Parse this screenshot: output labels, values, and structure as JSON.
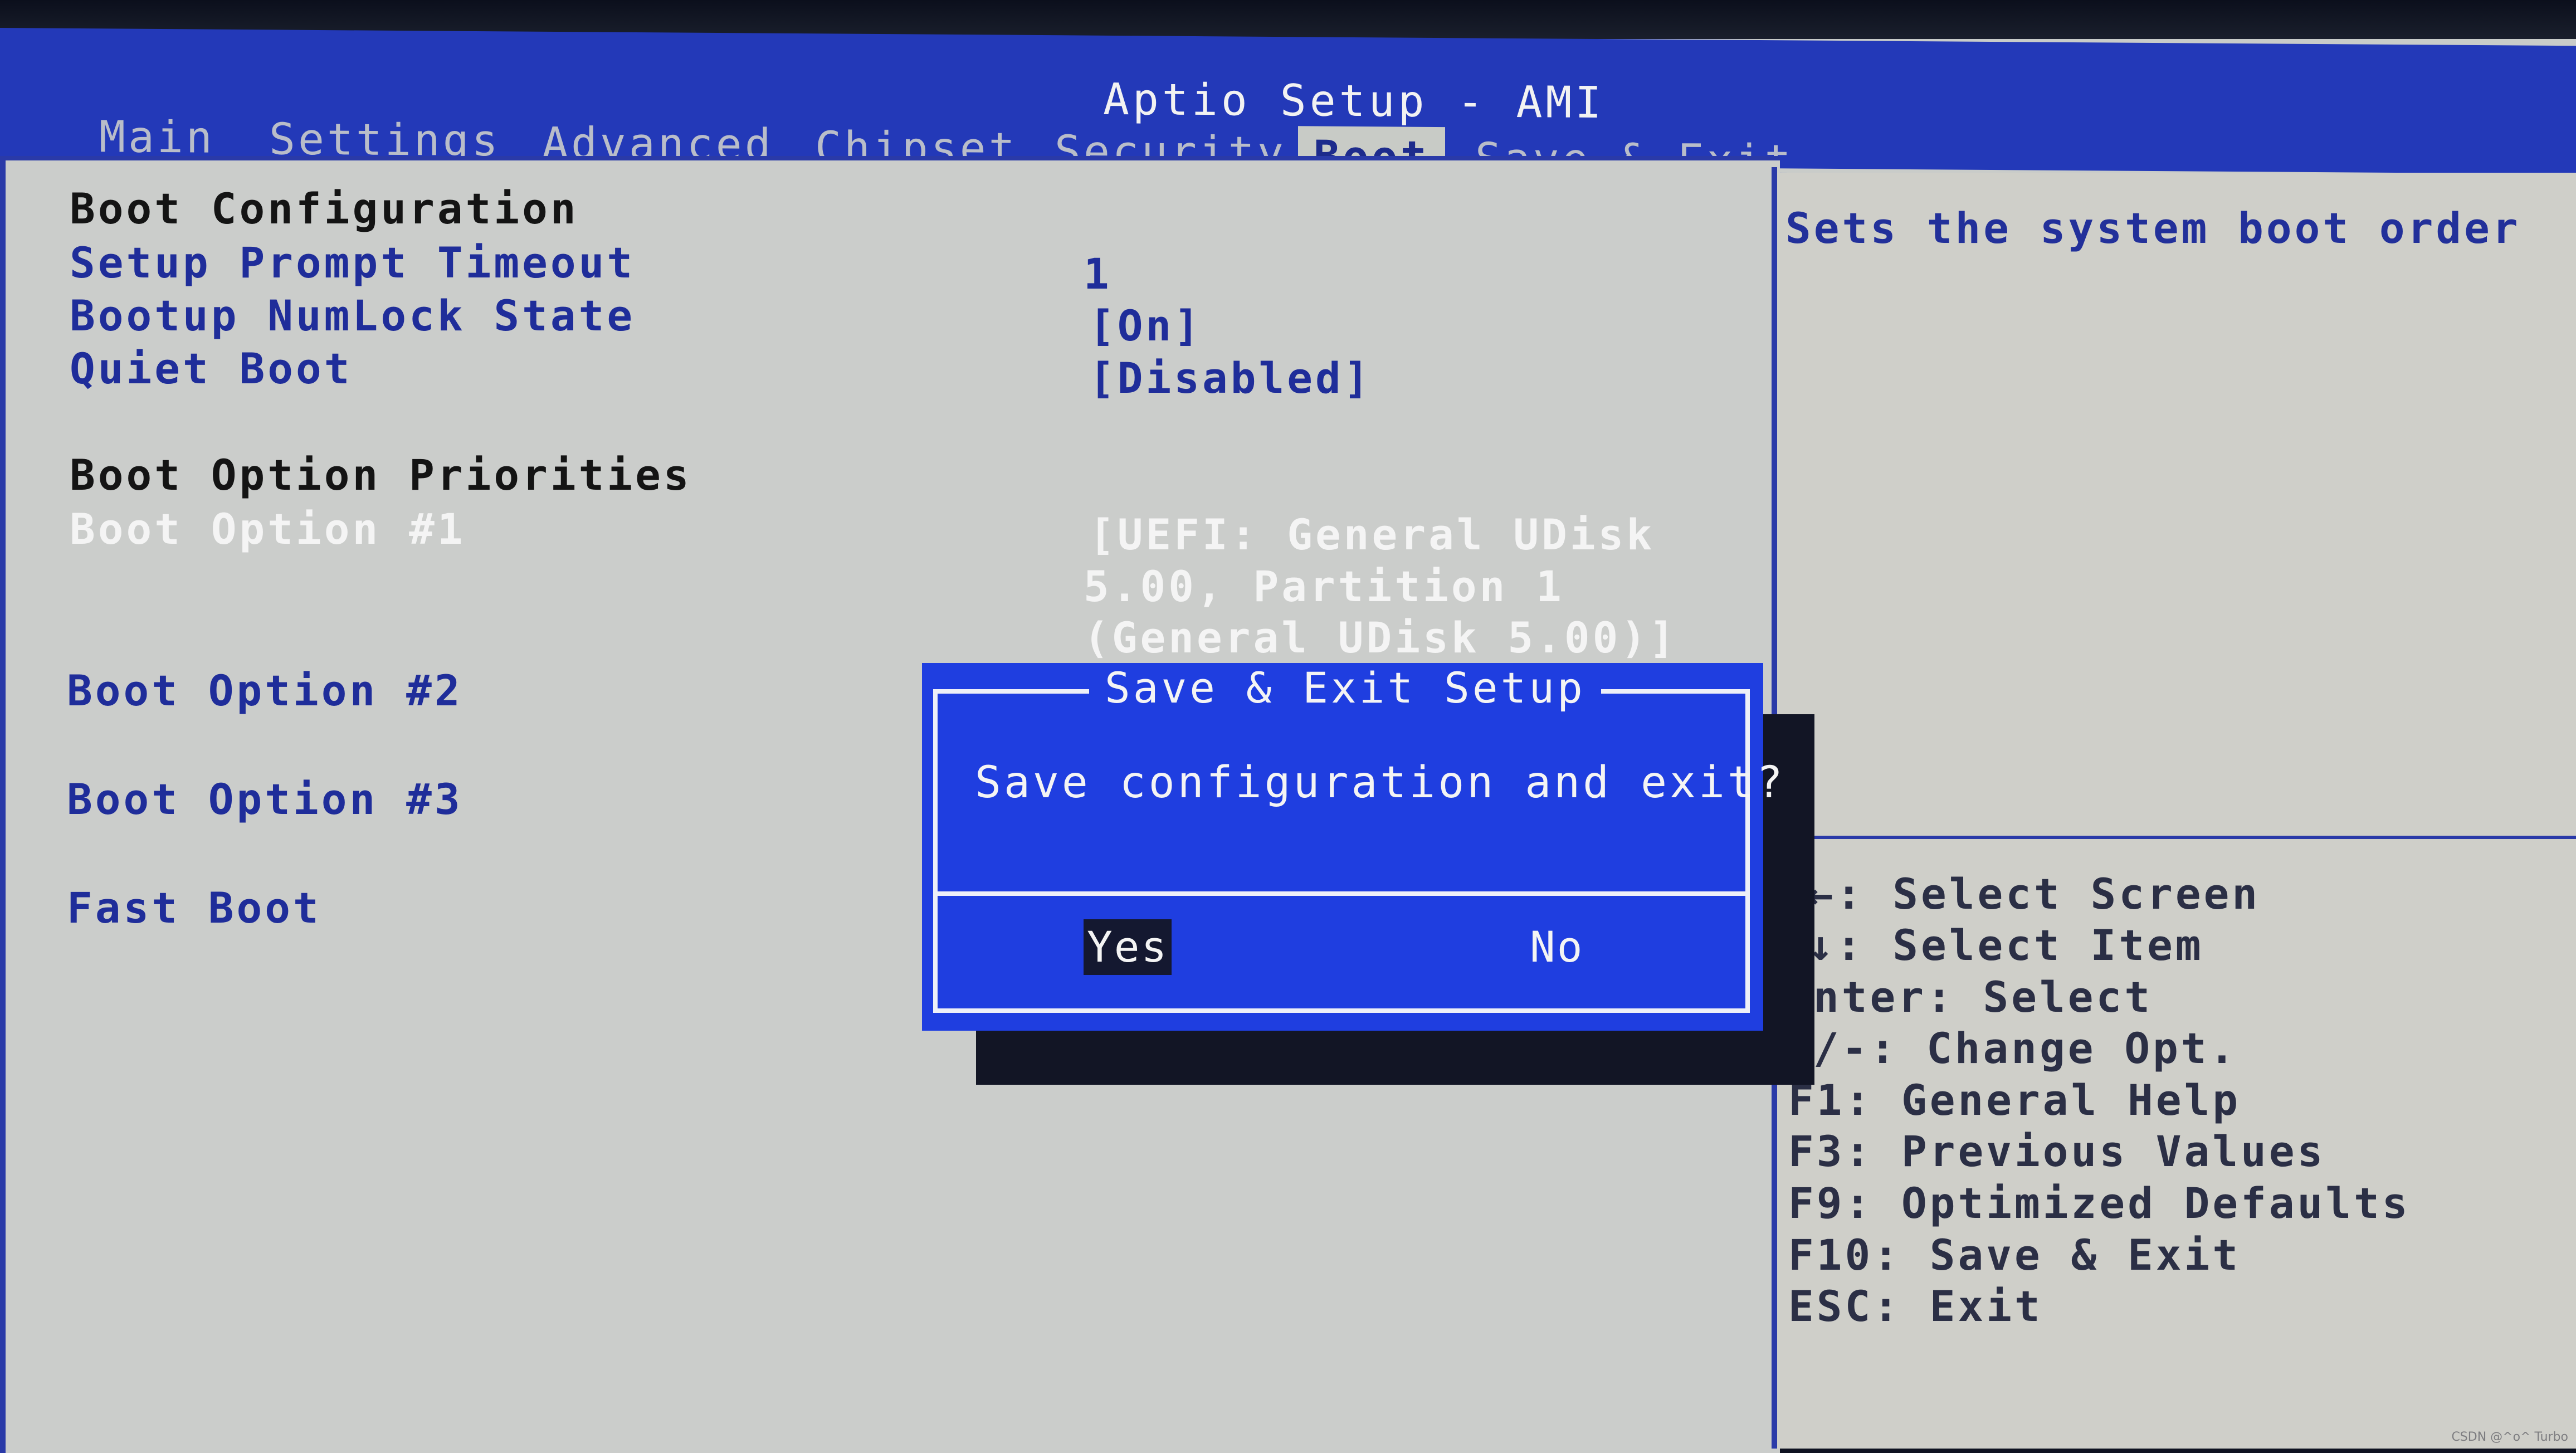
{
  "header": {
    "title": "Aptio Setup - AMI",
    "tabs": [
      {
        "label": "Main",
        "active": false
      },
      {
        "label": "Settings",
        "active": false
      },
      {
        "label": "Advanced",
        "active": false
      },
      {
        "label": "Chipset",
        "active": false
      },
      {
        "label": "Security",
        "active": false
      },
      {
        "label": "Boot",
        "active": true
      },
      {
        "label": "Save & Exit",
        "active": false
      }
    ]
  },
  "boot": {
    "section_config": "Boot Configuration",
    "items": [
      {
        "label": "Setup Prompt Timeout",
        "value": "1"
      },
      {
        "label": "Bootup NumLock State",
        "value": "[On]"
      },
      {
        "label": "Quiet Boot",
        "value": "[Disabled]"
      }
    ],
    "section_priorities": "Boot Option Priorities",
    "options": [
      {
        "label": "Boot Option #1",
        "value_lines": [
          "[UEFI: General UDisk",
          "5.00, Partition 1",
          "(General UDisk 5.00)]"
        ],
        "selected": true
      },
      {
        "label": "Boot Option #2"
      },
      {
        "label": "Boot Option #3"
      }
    ],
    "fast_boot": {
      "label": "Fast Boot"
    }
  },
  "help": {
    "description": "Sets the system boot order",
    "keys": [
      "←: Select Screen",
      "↓: Select Item",
      "nter: Select",
      "/-: Change Opt.",
      "F1: General Help",
      "F3: Previous Values",
      "F9: Optimized Defaults",
      "F10: Save & Exit",
      "ESC: Exit"
    ]
  },
  "dialog": {
    "title": "Save & Exit Setup",
    "message": "Save configuration and exit?",
    "yes_label": "Yes",
    "no_label": "No",
    "focused": "Yes"
  },
  "watermark": "CSDN @^o^ Turbo",
  "colors": {
    "header_blue": "#2339b8",
    "dialog_blue": "#1f3ee0",
    "panel_gray": "#cbcdcb",
    "item_blue": "#1f2d9a"
  }
}
